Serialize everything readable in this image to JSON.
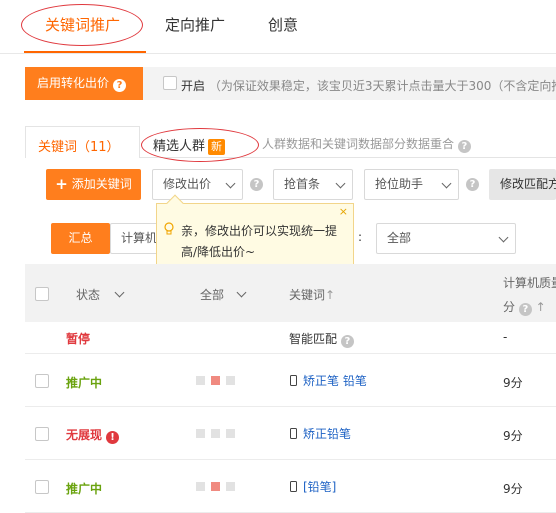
{
  "top_tabs": [
    {
      "label": "关键词推广",
      "active": true
    },
    {
      "label": "定向推广",
      "active": false
    },
    {
      "label": "创意",
      "active": false
    }
  ],
  "conversion": {
    "button_label": "启用转化出价",
    "toggle_label": "开启",
    "note": "（为保证效果稳定，该宝贝近3天累计点击量大于300（不含定向推"
  },
  "sub_tabs": {
    "keywords_label": "关键词（11）",
    "crowd_label": "精选人群",
    "new_badge": "新",
    "note": "人群数据和关键词数据部分数据重合"
  },
  "toolbar": {
    "add_keyword": "添加关键词",
    "modify_bid": "修改出价",
    "grab_top": "抢首条",
    "bid_helper": "抢位助手",
    "modify_match": "修改匹配方"
  },
  "tooltip": {
    "text": "亲，修改出价可以实现统一提高/降低出价~",
    "close": "×"
  },
  "filters": {
    "summary": "汇总",
    "device": "计算机",
    "colon": ":",
    "all": "全部"
  },
  "table": {
    "headers": {
      "status": "状态",
      "all": "全部",
      "keyword": "关键词",
      "quality_line1": "计算机质量",
      "quality_line2": "分"
    },
    "rows": [
      {
        "status": "暂停",
        "keyword": "智能匹配",
        "score": "-"
      },
      {
        "status": "推广中",
        "keyword": "矫正笔 铅笔",
        "score": "9分"
      },
      {
        "status": "无展现",
        "keyword": "矫正铅笔",
        "score": "9分"
      },
      {
        "status": "推广中",
        "keyword": "[铅笔]",
        "score": "9分"
      }
    ]
  },
  "colors": {
    "accent": "#ff6600",
    "button_orange": "#ff7e1d",
    "status_green": "#6aa30f",
    "status_red": "#e0393e",
    "link_blue": "#1e62c4"
  }
}
